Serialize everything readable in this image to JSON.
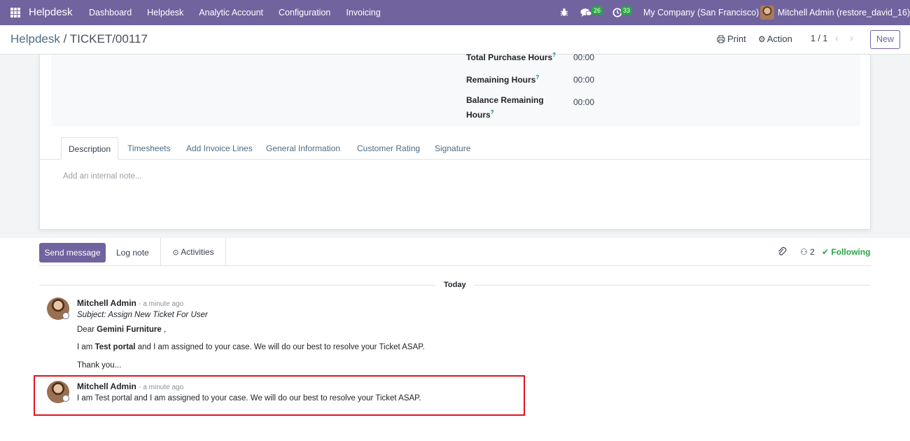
{
  "navbar": {
    "brand": "Helpdesk",
    "menu": [
      "Dashboard",
      "Helpdesk",
      "Analytic Account",
      "Configuration",
      "Invoicing"
    ],
    "messages_count": "26",
    "activities_count": "33",
    "company": "My Company (San Francisco)",
    "user": "Mitchell Admin (restore_david_16)"
  },
  "control_panel": {
    "breadcrumb_parent": "Helpdesk",
    "breadcrumb_sep": "/",
    "breadcrumb_current": "TICKET/00117",
    "print_label": "Print",
    "action_label": "Action",
    "pager": "1 / 1",
    "new_label": "New"
  },
  "form": {
    "fields": [
      {
        "label": "Total Purchase Hours",
        "value": "00:00"
      },
      {
        "label": "Remaining Hours",
        "value": "00:00"
      },
      {
        "label_line1": "Balance Remaining",
        "label_line2": "Hours",
        "value": "00:00"
      }
    ],
    "tabs": [
      "Description",
      "Timesheets",
      "Add Invoice Lines",
      "General Information",
      "Customer Rating",
      "Signature"
    ],
    "note_placeholder": "Add an internal note..."
  },
  "chatter": {
    "send_message": "Send message",
    "log_note": "Log note",
    "activities": "Activities",
    "followers_count": "2",
    "following_label": "Following",
    "date_separator": "Today",
    "messages": [
      {
        "author": "Mitchell Admin",
        "time": "- a minute ago",
        "subject": "Subject: Assign New Ticket For User",
        "greeting_prefix": "Dear ",
        "greeting_name": "Gemini Furniture",
        "greeting_suffix": " ,",
        "line_prefix": "I am ",
        "line_name": "Test portal",
        "line_suffix": " and I am assigned to your case. We will do our best to resolve your Ticket ASAP.",
        "closing": "Thank you..."
      },
      {
        "author": "Mitchell Admin",
        "time": "- a minute ago",
        "body": "I am Test portal and I am assigned to your case. We will do our best to resolve your Ticket ASAP."
      }
    ]
  },
  "colors": {
    "brand": "#71639e",
    "following": "#28a745",
    "highlight": "#e3131e"
  }
}
